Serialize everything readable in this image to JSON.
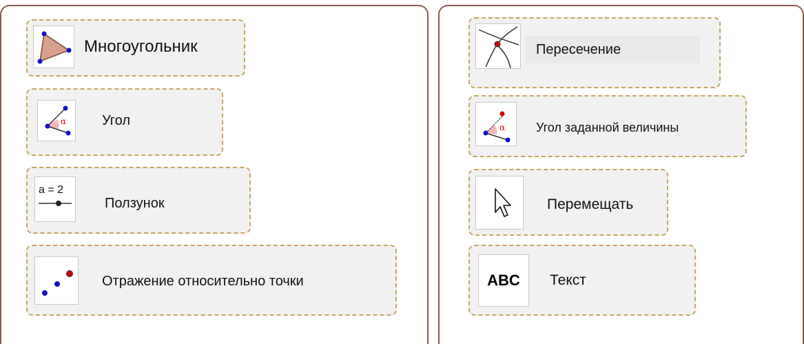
{
  "tools_left": [
    {
      "label": "Многоугольник",
      "icon": "polygon-icon"
    },
    {
      "label": "Угол",
      "icon": "angle-icon"
    },
    {
      "label": "Ползунок",
      "icon": "slider-icon",
      "icon_text": "a = 2"
    },
    {
      "label": "Отражение относительно точки",
      "icon": "reflect-about-point-icon"
    }
  ],
  "tools_right": [
    {
      "label": "Пересечение",
      "icon": "intersect-icon"
    },
    {
      "label": "Угол заданной величины",
      "icon": "angle-fixed-size-icon"
    },
    {
      "label": "Перемещать",
      "icon": "move-cursor-icon"
    },
    {
      "label": "Текст",
      "icon": "text-icon",
      "icon_text": "ABC"
    }
  ],
  "colors": {
    "panel_border": "#8a5a4e",
    "tool_border": "#c9a45c",
    "tool_bg": "#f1f1f1",
    "point_blue": "#1010c0",
    "point_red": "#d00000",
    "polygon_fill": "#d9a08c",
    "angle_fill": "#f5b8b8"
  }
}
